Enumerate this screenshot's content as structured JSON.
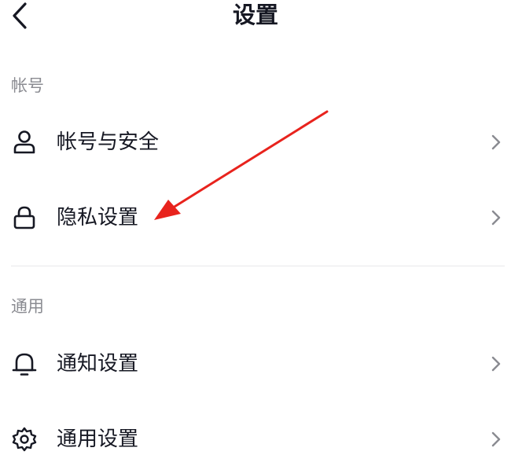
{
  "header": {
    "title": "设置",
    "back_icon": "chevron-left-icon"
  },
  "sections": [
    {
      "label": "帐号",
      "items": [
        {
          "label": "帐号与安全",
          "icon": "user-icon"
        },
        {
          "label": "隐私设置",
          "icon": "lock-icon"
        }
      ]
    },
    {
      "label": "通用",
      "items": [
        {
          "label": "通知设置",
          "icon": "bell-icon"
        },
        {
          "label": "通用设置",
          "icon": "gear-icon"
        }
      ]
    }
  ],
  "annotation": {
    "type": "arrow",
    "color": "#e8231d"
  }
}
